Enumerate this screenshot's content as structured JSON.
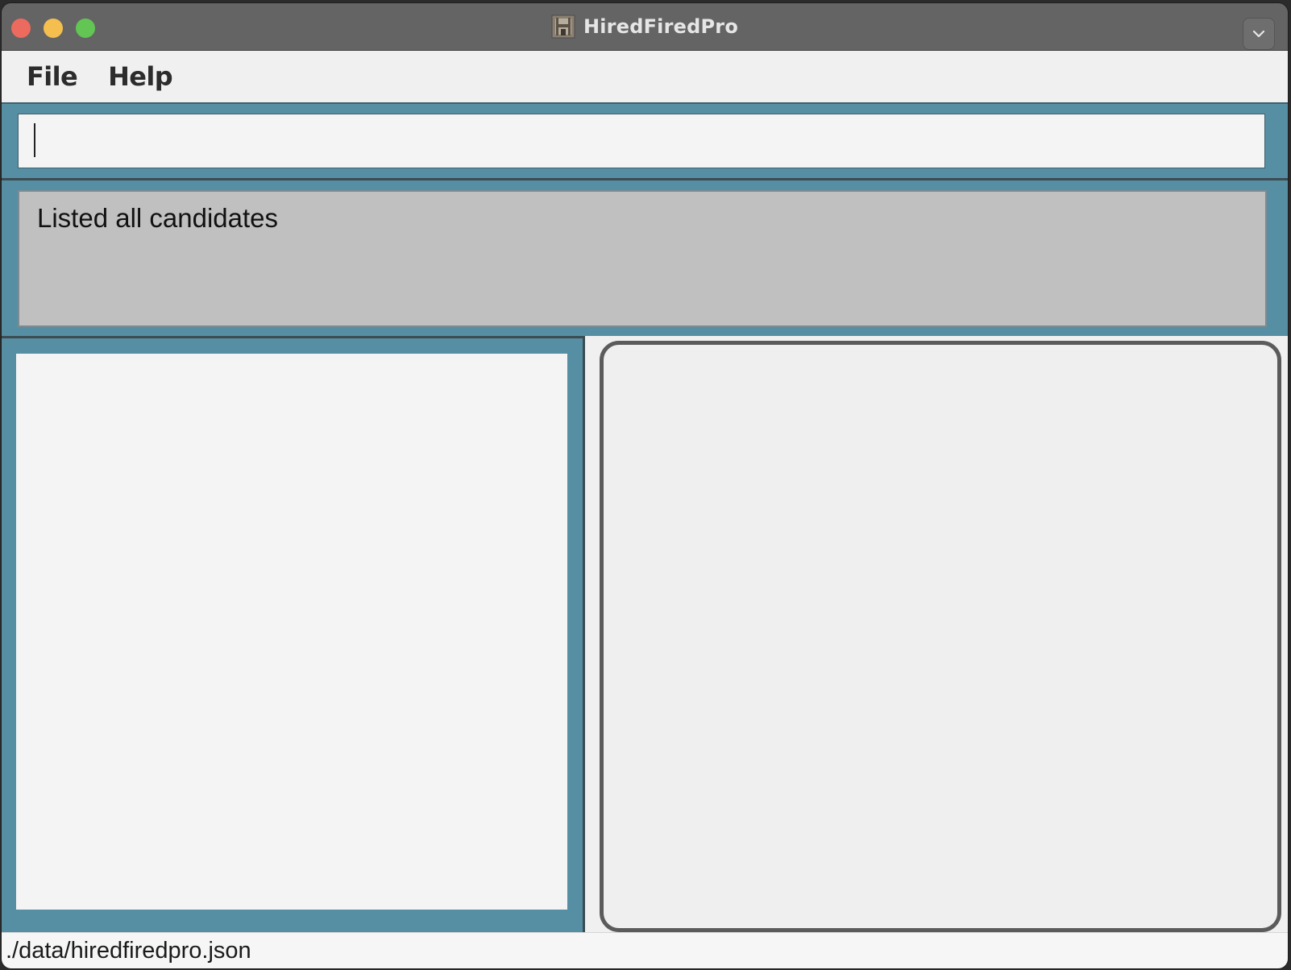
{
  "window": {
    "title": "HiredFiredPro",
    "app_icon": "castle-app-icon"
  },
  "menubar": {
    "items": [
      {
        "label": "File"
      },
      {
        "label": "Help"
      }
    ]
  },
  "command_box": {
    "value": "",
    "placeholder": ""
  },
  "result_display": {
    "text": "Listed all candidates"
  },
  "candidate_list": {
    "items": []
  },
  "status_bar": {
    "save_location": "./data/hiredfiredpro.json"
  },
  "colors": {
    "accent": "#568fa3",
    "result_bg": "#c0c0c0",
    "panel_border": "#5b5b5b"
  }
}
